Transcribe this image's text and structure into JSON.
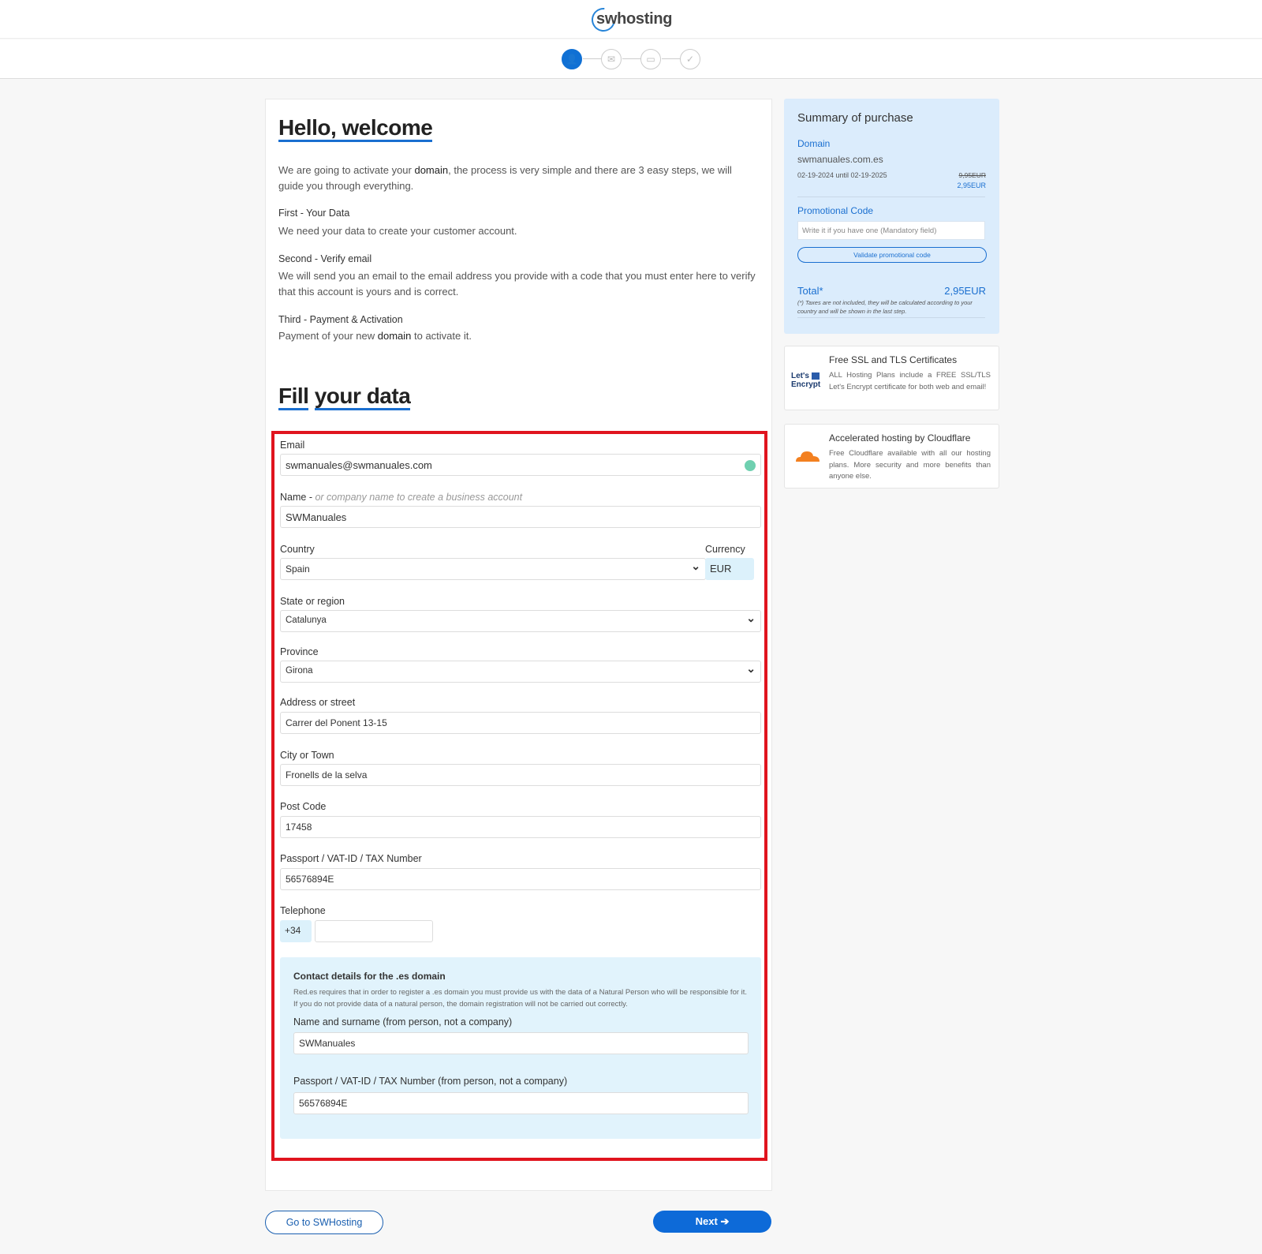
{
  "header": {
    "logo_text": "swhosting"
  },
  "steps": [
    {
      "name": "your-data",
      "icon": "user-icon",
      "glyph": "👤",
      "active": true
    },
    {
      "name": "verify-email",
      "icon": "mail-lock-icon",
      "glyph": "✉",
      "active": false
    },
    {
      "name": "payment",
      "icon": "credit-card-icon",
      "glyph": "▭",
      "active": false
    },
    {
      "name": "done",
      "icon": "check-icon",
      "glyph": "✓",
      "active": false
    }
  ],
  "intro": {
    "title": "Hello, welcome",
    "p1_a": "We are going to activate your ",
    "p1_b": "domain",
    "p1_c": ", the process is very simple and there are 3 easy steps, we will guide you through everything.",
    "step1_title": "First - Your Data",
    "step1_text": "We need your data to create your customer account.",
    "step2_title": "Second - Verify email",
    "step2_text": "We will send you an email to the email address you provide with a code that you must enter here to verify that this account is yours and is correct.",
    "step3_title": "Third - Payment & Activation",
    "step3_a": "Payment of your new ",
    "step3_b": "domain",
    "step3_c": " to activate it."
  },
  "form": {
    "title_a": "Fill",
    "title_b": "your data",
    "email_label": "Email",
    "email_value": "swmanuales@swmanuales.com",
    "name_label": "Name - ",
    "name_hint": "or company name to create a business account",
    "name_value": "SWManuales",
    "country_label": "Country",
    "country_value": "Spain",
    "currency_label": "Currency",
    "currency_value": "EUR",
    "state_label": "State or region",
    "state_value": "Catalunya",
    "province_label": "Province",
    "province_value": "Girona",
    "address_label": "Address or street",
    "address_value": "Carrer del Ponent 13-15",
    "city_label": "City or Town",
    "city_value": "Fronells de la selva",
    "postcode_label": "Post Code",
    "postcode_value": "17458",
    "taxid_label": "Passport / VAT-ID / TAX Number",
    "taxid_value": "56576894E",
    "phone_label": "Telephone",
    "phone_prefix": "+34",
    "phone_value": "",
    "es_title": "Contact details for the .es domain",
    "es_text": "Red.es requires that in order to register a .es domain you must provide us with the data of a Natural Person who will be responsible for it. If you do not provide data of a natural person, the domain registration will not be carried out correctly.",
    "es_name_label": "Name and surname (from person, not a company)",
    "es_name_value": "SWManuales",
    "es_taxid_label": "Passport / VAT-ID / TAX Number (from person, not a company)",
    "es_taxid_value": "56576894E"
  },
  "buttons": {
    "back": "Go to SWHosting",
    "next": "Next ➔"
  },
  "summary": {
    "title": "Summary of purchase",
    "domain_label": "Domain",
    "domain_name": "swmanuales.com.es",
    "period": "02-19-2024 until 02-19-2025",
    "old_price": "9,95EUR",
    "price": "2,95EUR",
    "promo_label": "Promotional Code",
    "promo_placeholder": "Write it if you have one (Mandatory field)",
    "promo_button": "Validate promotional code",
    "total_label": "Total*",
    "total_value": "2,95EUR",
    "tax_note": "(*) Taxes are not included, they will be calculated according to your country and will be shown in the last step."
  },
  "cards": [
    {
      "title": "Free SSL and TLS Certificates",
      "text": "ALL Hosting Plans include a FREE SSL/TLS Let's Encrypt certificate for both web and email!",
      "logo_a": "Let's",
      "logo_b": "Encrypt"
    },
    {
      "title": "Accelerated hosting by Cloudflare",
      "text": "Free Cloudflare available with all our hosting plans. More security and more benefits than anyone else."
    }
  ]
}
